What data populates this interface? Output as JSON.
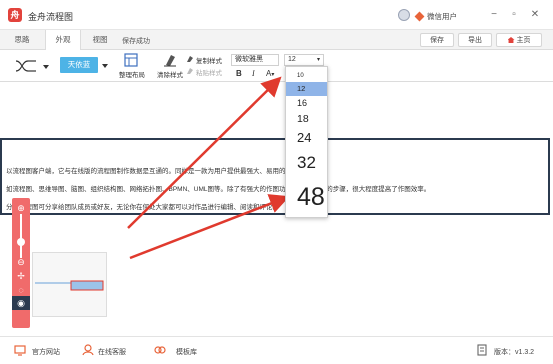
{
  "app": {
    "title": "金舟流程图",
    "logo_glyph": "舟",
    "user_name": "微信用户",
    "accent_color": "#e2433c",
    "window_buttons": [
      "−",
      "▫",
      "✕"
    ]
  },
  "tabs": [
    {
      "label": "思路",
      "active": false
    },
    {
      "label": "外观",
      "active": true
    },
    {
      "label": "视图",
      "active": false
    }
  ],
  "save_status": "保存成功",
  "top_buttons": {
    "save": "保存",
    "export": "导出",
    "home": "主页"
  },
  "toolbar": {
    "theme_label": "天依蓝",
    "arrange_label": "整理布局",
    "clear_style_label": "清除样式",
    "copy_style_label": "复制样式",
    "paste_style_label": "粘贴样式",
    "font_family": "微软雅黑",
    "font_size": "12",
    "bold": "B",
    "italic": "I",
    "font_color": "A"
  },
  "size_dropdown": {
    "options": [
      "10",
      "12",
      "16",
      "18",
      "24",
      "32",
      "48"
    ],
    "selected": "12"
  },
  "content": {
    "lines": [
      "以流程图客户端，它与在线版的流程图制作数据是互通的。同样是一款为用户提供最强大、易用的作",
      "如流程图、思维导图、脑图、组织结构图、网络拓扑图、BPMN、UML图等。除了有强大的作图功能                                  着去了设计的步骤，很大程度提高了作图效率。",
      "分享流程图可分享给团队成员或好友，无论你在何处大家都可以对作品进行编辑、阅读和评论。"
    ]
  },
  "zoom_panel": {
    "icons": [
      "zoom-in-icon",
      "zoom-out-icon",
      "move-icon",
      "fit-icon",
      "eye-icon"
    ],
    "color": "#f06b6b"
  },
  "status_bar": {
    "website": "官方网站",
    "support": "在线客服",
    "templates": "模板库",
    "version": "版本：v1.3.2"
  }
}
